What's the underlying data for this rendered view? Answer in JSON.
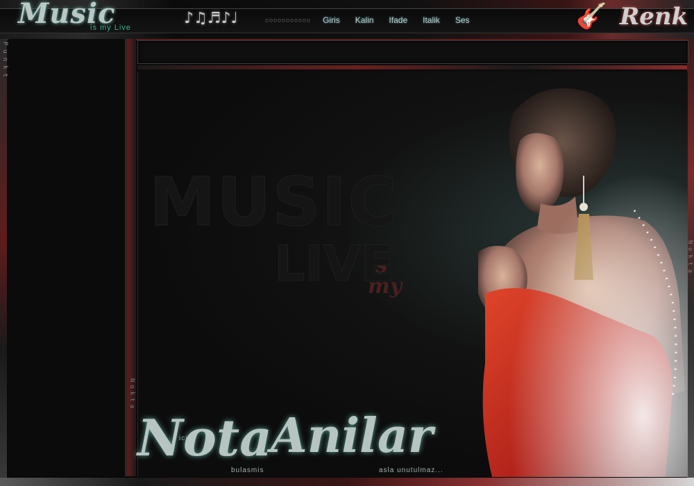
{
  "header": {
    "brand_main": "Music",
    "brand_sub": "is my Live",
    "notes_glyphs": "♪♫♬♪♩",
    "nav": [
      {
        "label": "Giris"
      },
      {
        "label": "Kalin"
      },
      {
        "label": "Ifade"
      },
      {
        "label": "Italik"
      },
      {
        "label": "Ses"
      }
    ],
    "guitar_glyph": "🎸",
    "color_label": "Renk"
  },
  "sidebar": {
    "vertical_label": "Punkt"
  },
  "side_labels": {
    "left": "Nokta",
    "right": "Nokta"
  },
  "watermark": {
    "line1": "MUSIC",
    "script": "is my",
    "line2": "LIVE"
  },
  "caption": {
    "icine": "icine",
    "nota": "Nota",
    "bulasmis": "bulasmis",
    "anilar": "Anilar",
    "asla": "asla unutulmaz..."
  },
  "colors": {
    "accent_teal": "#33b58f",
    "accent_red": "#8a2a2a",
    "dress_red": "#c0281c"
  }
}
